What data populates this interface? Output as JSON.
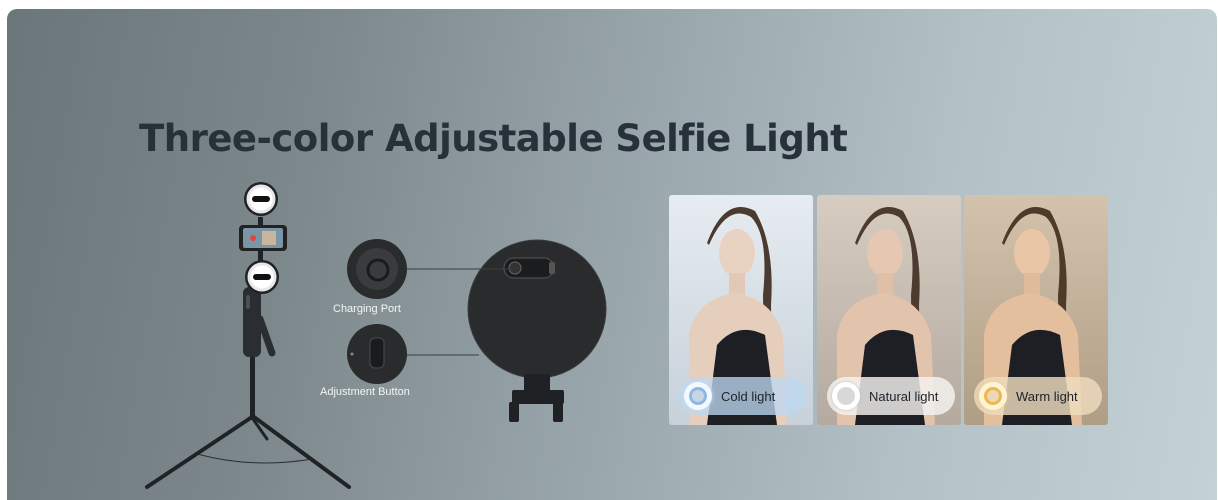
{
  "banner": {
    "title": "Three-color Adjustable Selfie Light"
  },
  "callouts": {
    "charging_port": "Charging Port",
    "adjustment_button": "Adjustment Button"
  },
  "light_modes": [
    {
      "label": "Cold light",
      "ring_color": "#8db8e6"
    },
    {
      "label": "Natural light",
      "ring_color": "#d8d8d8"
    },
    {
      "label": "Warm light",
      "ring_color": "#e9b94a"
    }
  ],
  "colors": {
    "title": "#26313a",
    "background_left": "#6b767a",
    "background_right": "#c4d2d7"
  }
}
